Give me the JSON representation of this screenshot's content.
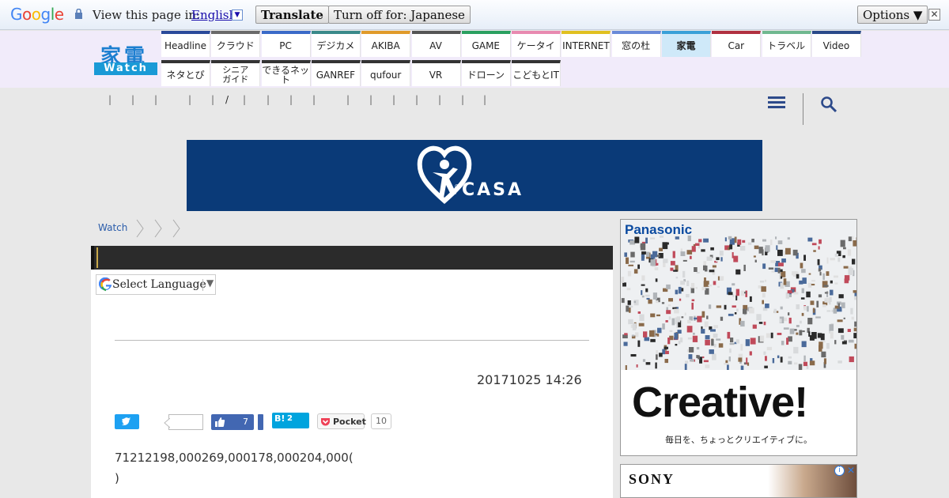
{
  "translate_bar": {
    "logo": [
      "G",
      "o",
      "o",
      "g",
      "l",
      "e"
    ],
    "logo_colors": [
      "#4285f4",
      "#ea4335",
      "#fbbc05",
      "#4285f4",
      "#34a853",
      "#ea4335"
    ],
    "view_label": "View this page in:",
    "language": "English",
    "translate_button": "Translate",
    "turn_off_button": "Turn off for: Japanese",
    "options_button": "Options ▼",
    "close": "✕"
  },
  "site": {
    "logo_kanji": "家電",
    "logo_sub": "Watch",
    "accent": "#1a9ad6"
  },
  "nav": {
    "row1": [
      {
        "label": "Headline",
        "color": "#2a4a9a"
      },
      {
        "label": "クラウド",
        "color": "#6a6a6a"
      },
      {
        "label": "PC",
        "color": "#3a6ac8"
      },
      {
        "label": "デジカメ",
        "color": "#3a8a8a"
      },
      {
        "label": "AKIBA",
        "color": "#e09a2a"
      },
      {
        "label": "AV",
        "color": "#555555"
      },
      {
        "label": "GAME",
        "color": "#2aa060"
      },
      {
        "label": "ケータイ",
        "color": "#e88ab0"
      },
      {
        "label": "INTERNET",
        "color": "#e0c020"
      },
      {
        "label": "窓の杜",
        "color": "#6a8ad8"
      },
      {
        "label": "家電",
        "color": "#3aa0d8"
      },
      {
        "label": "Car",
        "color": "#b03040"
      },
      {
        "label": "トラベル",
        "color": "#70b890"
      },
      {
        "label": "Video",
        "color": "#2a4a8a"
      }
    ],
    "row2": [
      {
        "label": "ネタとぴ",
        "color": "#333333"
      },
      {
        "label": "シニア\nガイド",
        "color": "#333333"
      },
      {
        "label": "できるネット",
        "color": "#333333"
      },
      {
        "label": "GANREF",
        "color": "#333333"
      },
      {
        "label": "qufour",
        "color": "#333333"
      },
      {
        "label": "VR",
        "color": "#333333"
      },
      {
        "label": "ドローン",
        "color": "#333333"
      },
      {
        "label": "こどもとIT",
        "color": "#333333"
      }
    ],
    "active": "家電"
  },
  "subnav": {
    "separators": [
      "|",
      "|",
      "|",
      "|",
      "|",
      "/",
      "|",
      "|",
      "|",
      "|",
      "|",
      "|",
      "|",
      "|",
      "|",
      "|",
      "|"
    ]
  },
  "banner": {
    "text": "CASA",
    "color": "#0a3a78"
  },
  "breadcrumb": {
    "root": "Watch"
  },
  "article": {
    "language_select": "Select Language",
    "date": "20171025 14:26",
    "facebook_count": "7",
    "hatena_label": "B!",
    "hatena_count": "2",
    "pocket_label": "Pocket",
    "pocket_count": "10",
    "body_line1": "71212198,000269,000178,000204,000(",
    "body_line2": ")"
  },
  "ads": {
    "ad1_brand": "Panasonic",
    "ad1_headline": "Creative!",
    "ad1_sub": "毎日を、ちょっとクリエイティブに。",
    "ad2_brand": "SONY",
    "ad2_info": "i",
    "ad2_close": "✕"
  }
}
